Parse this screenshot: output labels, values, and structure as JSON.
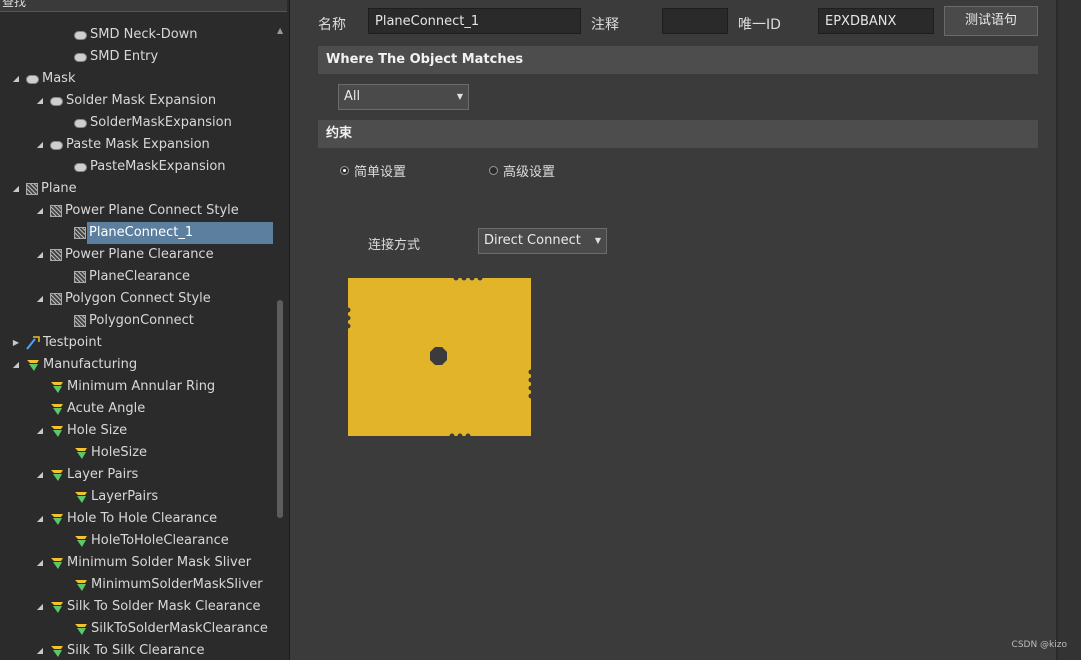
{
  "tree": {
    "search_label": "查找",
    "items": [
      {
        "label": "SMD Neck-Down",
        "icon": "pill",
        "level": 2,
        "expander": ""
      },
      {
        "label": "SMD Entry",
        "icon": "pill",
        "level": 2,
        "expander": ""
      },
      {
        "label": "Mask",
        "icon": "pill",
        "level": 0,
        "expander": "◢"
      },
      {
        "label": "Solder Mask Expansion",
        "icon": "pill",
        "level": 1,
        "expander": "◢"
      },
      {
        "label": "SolderMaskExpansion",
        "icon": "pill",
        "level": 2,
        "expander": ""
      },
      {
        "label": "Paste Mask Expansion",
        "icon": "pill",
        "level": 1,
        "expander": "◢"
      },
      {
        "label": "PasteMaskExpansion",
        "icon": "pill",
        "level": 2,
        "expander": ""
      },
      {
        "label": "Plane",
        "icon": "hatch",
        "level": 0,
        "expander": "◢"
      },
      {
        "label": "Power Plane Connect Style",
        "icon": "hatch",
        "level": 1,
        "expander": "◢"
      },
      {
        "label": "PlaneConnect_1",
        "icon": "hatch",
        "level": 2,
        "expander": "",
        "selected": true
      },
      {
        "label": "Power Plane Clearance",
        "icon": "hatch",
        "level": 1,
        "expander": "◢"
      },
      {
        "label": "PlaneClearance",
        "icon": "hatch",
        "level": 2,
        "expander": ""
      },
      {
        "label": "Polygon Connect Style",
        "icon": "hatch",
        "level": 1,
        "expander": "◢"
      },
      {
        "label": "PolygonConnect",
        "icon": "hatch",
        "level": 2,
        "expander": ""
      },
      {
        "label": "Testpoint",
        "icon": "probe",
        "level": 0,
        "expander": "▶"
      },
      {
        "label": "Manufacturing",
        "icon": "flag",
        "level": 0,
        "expander": "◢"
      },
      {
        "label": "Minimum Annular Ring",
        "icon": "flag",
        "level": 1,
        "expander": ""
      },
      {
        "label": "Acute Angle",
        "icon": "flag",
        "level": 1,
        "expander": ""
      },
      {
        "label": "Hole Size",
        "icon": "flag",
        "level": 1,
        "expander": "◢"
      },
      {
        "label": "HoleSize",
        "icon": "flag",
        "level": 2,
        "expander": ""
      },
      {
        "label": "Layer Pairs",
        "icon": "flag",
        "level": 1,
        "expander": "◢"
      },
      {
        "label": "LayerPairs",
        "icon": "flag",
        "level": 2,
        "expander": ""
      },
      {
        "label": "Hole To Hole Clearance",
        "icon": "flag",
        "level": 1,
        "expander": "◢"
      },
      {
        "label": "HoleToHoleClearance",
        "icon": "flag",
        "level": 2,
        "expander": ""
      },
      {
        "label": "Minimum Solder Mask Sliver",
        "icon": "flag",
        "level": 1,
        "expander": "◢"
      },
      {
        "label": "MinimumSolderMaskSliver",
        "icon": "flag",
        "level": 2,
        "expander": ""
      },
      {
        "label": "Silk To Solder Mask Clearance",
        "icon": "flag",
        "level": 1,
        "expander": "◢"
      },
      {
        "label": "SilkToSolderMaskClearance",
        "icon": "flag",
        "level": 2,
        "expander": ""
      },
      {
        "label": "Silk To Silk Clearance",
        "icon": "flag",
        "level": 1,
        "expander": "◢"
      }
    ]
  },
  "header": {
    "name_label": "名称",
    "name_value": "PlaneConnect_1",
    "comment_label": "注释",
    "comment_value": "",
    "uid_label": "唯一ID",
    "uid_value": "EPXDBANX",
    "test_button": "测试语句"
  },
  "where": {
    "title": "Where The Object Matches",
    "scope_value": "All"
  },
  "constraints": {
    "title": "约束",
    "simple_label": "简单设置",
    "advanced_label": "高级设置",
    "simple_selected": true,
    "connect_label": "连接方式",
    "connect_value": "Direct Connect",
    "plane_color": "#e2b42a"
  },
  "watermark": "CSDN @kizo"
}
